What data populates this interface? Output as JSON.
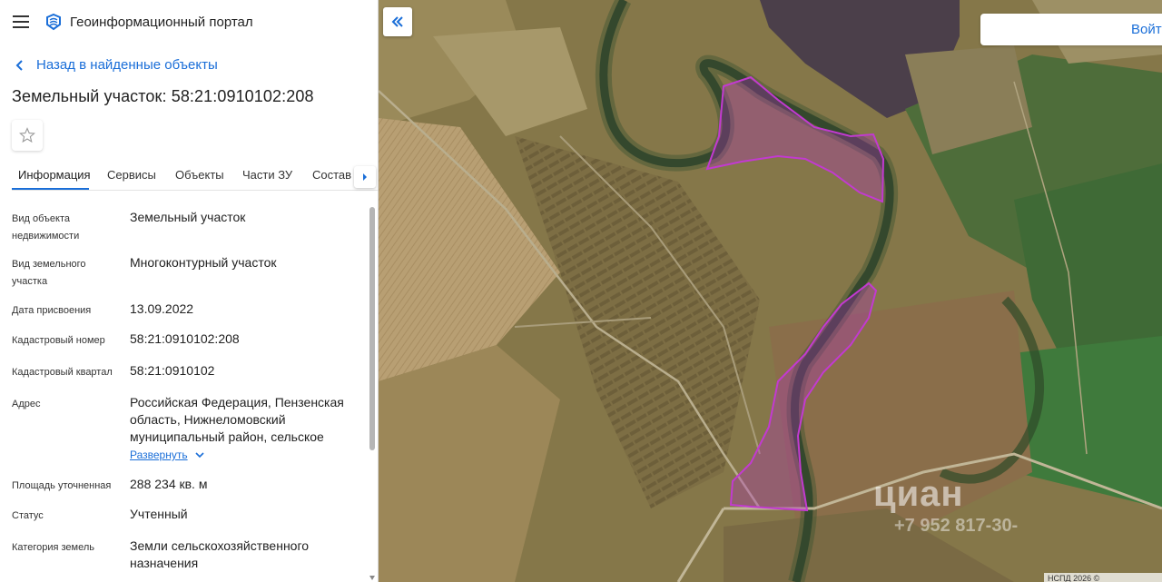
{
  "app": {
    "title": "Геоинформационный портал"
  },
  "nav": {
    "back_label": "Назад в найденные объекты"
  },
  "object": {
    "title": "Земельный участок: 58:21:0910102:208"
  },
  "tabs": [
    {
      "label": "Информация",
      "active": true
    },
    {
      "label": "Сервисы"
    },
    {
      "label": "Объекты"
    },
    {
      "label": "Части ЗУ"
    },
    {
      "label": "Состав"
    }
  ],
  "info": {
    "type": {
      "label": "Вид объекта недвижимости",
      "value": "Земельный участок"
    },
    "land_type": {
      "label": "Вид земельного участка",
      "value": "Многоконтурный участок"
    },
    "date": {
      "label": "Дата присвоения",
      "value": "13.09.2022"
    },
    "cadastral_number": {
      "label": "Кадастровый номер",
      "value": "58:21:0910102:208"
    },
    "cadastral_quarter": {
      "label": "Кадастровый квартал",
      "value": "58:21:0910102"
    },
    "address": {
      "label": "Адрес",
      "value": "Российская Федерация, Пензенская область, Нижнеломовский муниципальный район, сельское",
      "expand_label": "Развернуть"
    },
    "area": {
      "label": "Площадь уточненная",
      "value": "288 234 кв. м"
    },
    "status": {
      "label": "Статус",
      "value": "Учтенный"
    },
    "category": {
      "label": "Категория земель",
      "value": "Земли сельскохозяйственного назначения"
    }
  },
  "map": {
    "login_label": "Войти",
    "watermark": "циан",
    "watermark_number": "+7 952 817-30-",
    "attribution": "НСПД 2026 ©",
    "parcel_color": "#b02ec0"
  },
  "colors": {
    "accent": "#1a6ed8"
  }
}
